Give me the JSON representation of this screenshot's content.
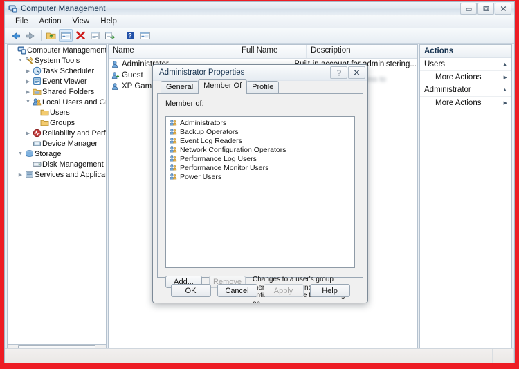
{
  "window": {
    "title": "Computer Management",
    "icon": "computer-management-icon",
    "buttons": {
      "minimize": "–",
      "maximize": "❐",
      "close": "✕"
    }
  },
  "menubar": {
    "items": [
      "File",
      "Action",
      "View",
      "Help"
    ]
  },
  "toolbar": {
    "buttons": [
      {
        "name": "back-icon",
        "glyph": "←"
      },
      {
        "name": "forward-icon",
        "glyph": "→"
      },
      {
        "name": "up-folder-icon",
        "glyph": "↑"
      },
      {
        "name": "show-hide-tree-icon",
        "glyph": "▤"
      },
      {
        "name": "delete-icon",
        "glyph": "✕"
      },
      {
        "name": "properties-icon",
        "glyph": "▤"
      },
      {
        "name": "export-list-icon",
        "glyph": "➡"
      },
      {
        "name": "help-icon",
        "glyph": "?"
      },
      {
        "name": "view-icon",
        "glyph": "▤"
      }
    ]
  },
  "tree": {
    "nodes": [
      {
        "label": "Computer Management (Local",
        "depth": 0,
        "twisty": "",
        "icon": "computer-icon"
      },
      {
        "label": "System Tools",
        "depth": 1,
        "twisty": "▼",
        "icon": "system-tools-icon"
      },
      {
        "label": "Task Scheduler",
        "depth": 2,
        "twisty": "▶",
        "icon": "clock-icon"
      },
      {
        "label": "Event Viewer",
        "depth": 2,
        "twisty": "▶",
        "icon": "event-viewer-icon"
      },
      {
        "label": "Shared Folders",
        "depth": 2,
        "twisty": "▶",
        "icon": "shared-folders-icon"
      },
      {
        "label": "Local Users and Groups",
        "depth": 2,
        "twisty": "▼",
        "icon": "users-groups-icon"
      },
      {
        "label": "Users",
        "depth": 3,
        "twisty": "",
        "icon": "folder-icon"
      },
      {
        "label": "Groups",
        "depth": 3,
        "twisty": "",
        "icon": "folder-icon"
      },
      {
        "label": "Reliability and Performa",
        "depth": 2,
        "twisty": "▶",
        "icon": "reliability-icon"
      },
      {
        "label": "Device Manager",
        "depth": 2,
        "twisty": "",
        "icon": "device-manager-icon"
      },
      {
        "label": "Storage",
        "depth": 1,
        "twisty": "▼",
        "icon": "storage-icon"
      },
      {
        "label": "Disk Management",
        "depth": 2,
        "twisty": "",
        "icon": "disk-icon"
      },
      {
        "label": "Services and Applications",
        "depth": 1,
        "twisty": "▶",
        "icon": "services-icon"
      }
    ],
    "scrollbar": {
      "left_arrow": "◀",
      "right_arrow": "▶",
      "grip": "⋮"
    }
  },
  "list": {
    "columns": [
      "Name",
      "Full Name",
      "Description"
    ],
    "rows": [
      {
        "name": "Administrator",
        "full_name": "",
        "description": "Built-in account for administering...",
        "icon": "user-icon"
      },
      {
        "name": "Guest",
        "full_name": "",
        "description": "",
        "icon": "user-add-icon"
      },
      {
        "name": "XP Gaming ...",
        "full_name": "",
        "description": "",
        "icon": "user-icon"
      }
    ],
    "obscured_text": "Built-in account for guest access to"
  },
  "actions": {
    "title": "Actions",
    "groups": [
      {
        "label": "Users",
        "collapse_caret": "▲",
        "items": [
          {
            "label": "More Actions",
            "caret": "▶"
          }
        ]
      },
      {
        "label": "Administrator",
        "collapse_caret": "▲",
        "items": [
          {
            "label": "More Actions",
            "caret": "▶"
          }
        ]
      }
    ]
  },
  "dialog": {
    "title": "Administrator Properties",
    "titlebar_buttons": {
      "help": "⍰",
      "close": "✕"
    },
    "tabs": [
      {
        "label": "General",
        "active": false
      },
      {
        "label": "Member Of",
        "active": true
      },
      {
        "label": "Profile",
        "active": false
      }
    ],
    "member_of_label": "Member of:",
    "members": [
      "Administrators",
      "Backup Operators",
      "Event Log Readers",
      "Network Configuration Operators",
      "Performance Log Users",
      "Performance Monitor Users",
      "Power Users"
    ],
    "member_icon": "group-icon",
    "add_button": "Add...",
    "remove_button": "Remove",
    "note": "Changes to a user's group membership are not effective until the next time the user logs on.",
    "footer_buttons": [
      {
        "label": "OK",
        "disabled": false
      },
      {
        "label": "Cancel",
        "disabled": false
      },
      {
        "label": "Apply",
        "disabled": true
      },
      {
        "label": "Help",
        "disabled": false
      }
    ]
  },
  "statusbar": {
    "text": ""
  },
  "colors": {
    "frame_red": "#ed1c24",
    "titlebar_text": "#16324f",
    "accent_blue": "#2f6fb5"
  }
}
